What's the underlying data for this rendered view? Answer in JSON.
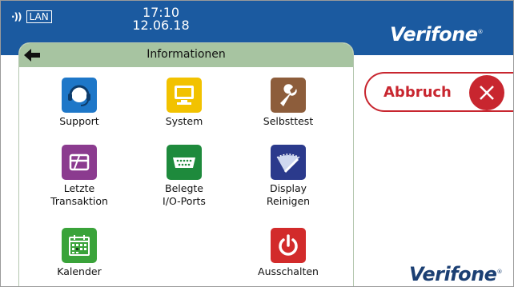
{
  "status": {
    "signal_icon": "signal-icon",
    "network": "LAN",
    "time": "17:10",
    "date": "12.06.18"
  },
  "brand": {
    "name": "Verifone",
    "mark": "®"
  },
  "panel": {
    "title": "Informationen"
  },
  "tiles": [
    {
      "label": "Support",
      "color": "#1e77c8"
    },
    {
      "label": "System",
      "color": "#f2c200"
    },
    {
      "label": "Selbsttest",
      "color": "#8d5d3b"
    },
    {
      "label": "Letzte\nTransaktion",
      "color": "#8b3b8f"
    },
    {
      "label": "Belegte\nI/O-Ports",
      "color": "#1e8a3c"
    },
    {
      "label": "Display\nReinigen",
      "color": "#2b3a8c"
    },
    {
      "label": "Kalender",
      "color": "#3aa33a"
    },
    {
      "label": "Ausschalten",
      "color": "#d22b2b"
    }
  ],
  "cancel": {
    "label": "Abbruch"
  }
}
